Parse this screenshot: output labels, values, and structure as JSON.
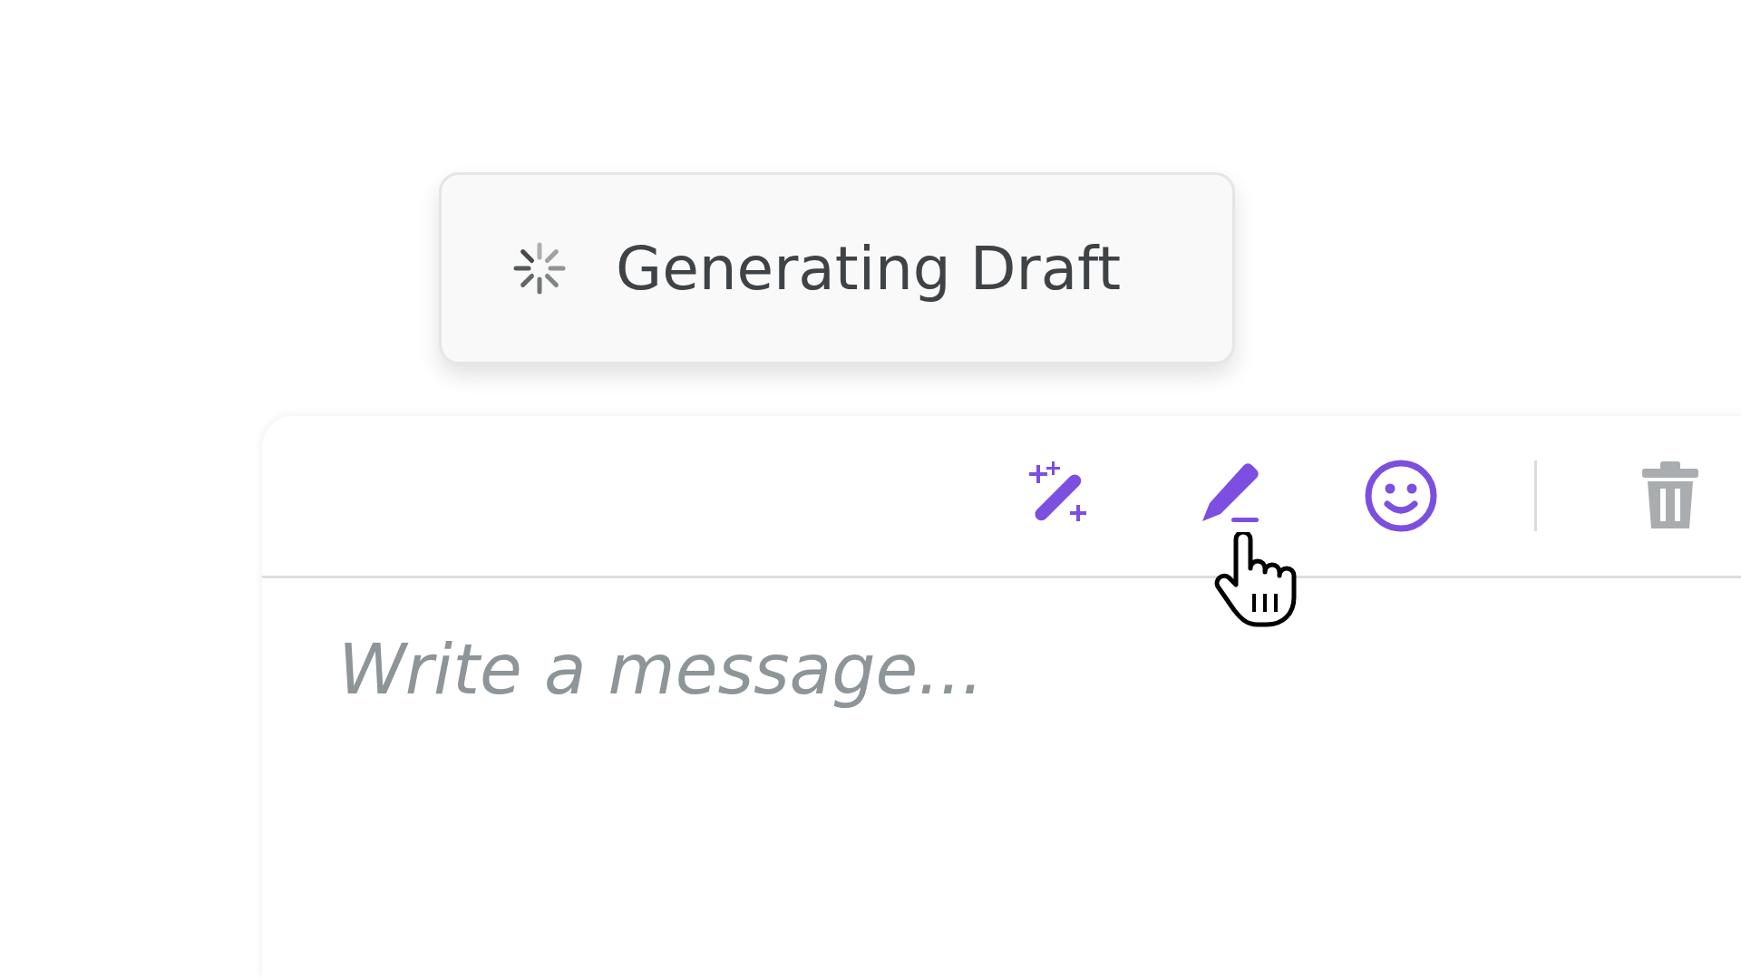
{
  "toast": {
    "label": "Generating Draft"
  },
  "toolbar": [
    {
      "kind": "magic",
      "disabled": false
    },
    {
      "kind": "pencil",
      "disabled": false
    },
    {
      "kind": "emoji",
      "disabled": false
    },
    {
      "kind": "divider"
    },
    {
      "kind": "trash",
      "disabled": true
    }
  ],
  "composer": {
    "placeholder": "Write a message..."
  }
}
